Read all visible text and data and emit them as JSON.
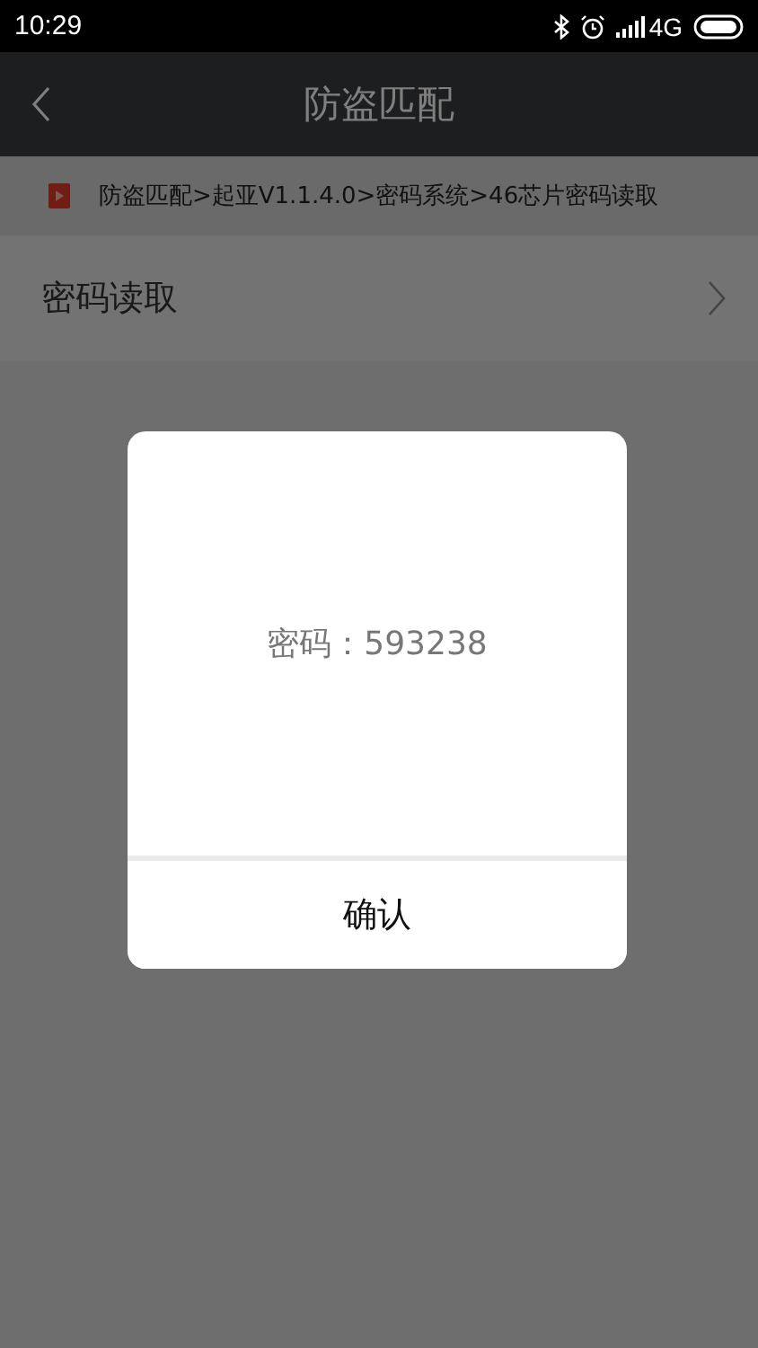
{
  "status_bar": {
    "time": "10:29",
    "network": "4G"
  },
  "nav_bar": {
    "title": "防盗匹配"
  },
  "breadcrumb": {
    "text": "防盗匹配>起亚V1.1.4.0>密码系统>46芯片密码读取"
  },
  "list_items": [
    {
      "label": "密码读取"
    }
  ],
  "dialog": {
    "message": "密码：593238",
    "button": "确认"
  }
}
